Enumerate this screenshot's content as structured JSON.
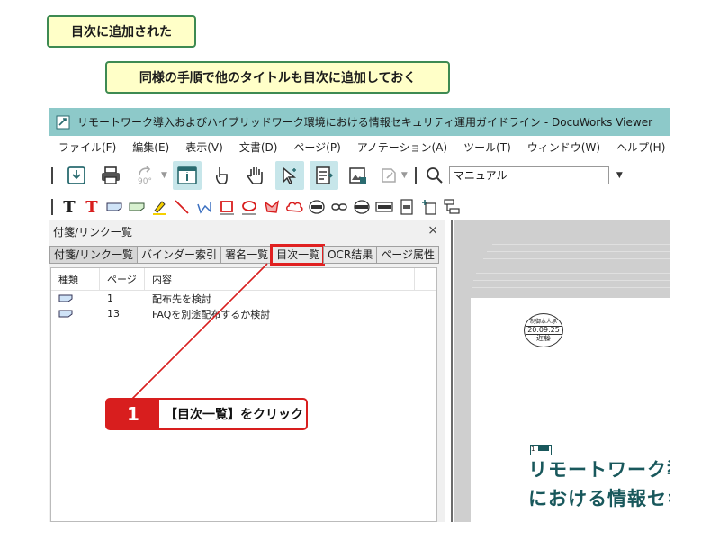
{
  "callouts": {
    "added": "目次に追加された",
    "repeat": "同様の手順で他のタイトルも目次に追加しておく"
  },
  "window": {
    "title": "リモートワーク導入およびハイブリッドワーク環境における情報セキュリティ運用ガイドライン - DocuWorks Viewer",
    "menu": [
      "ファイル(F)",
      "編集(E)",
      "表示(V)",
      "文書(D)",
      "ページ(P)",
      "アノテーション(A)",
      "ツール(T)",
      "ウィンドウ(W)",
      "ヘルプ(H)"
    ],
    "toolbar": {
      "rotate_label": "90°",
      "search_value": "マニュアル"
    }
  },
  "panel": {
    "title": "付箋/リンク一覧",
    "close": "×",
    "tabs": [
      "付箋/リンク一覧",
      "バインダー索引",
      "署名一覧",
      "目次一覧",
      "OCR結果",
      "ページ属性"
    ],
    "columns": [
      "種類",
      "ページ",
      "内容"
    ],
    "rows": [
      {
        "page": "1",
        "content": "配布先を検討"
      },
      {
        "page": "13",
        "content": "FAQを別途配布するか検討"
      }
    ]
  },
  "viewer": {
    "stamp": {
      "top": "制御本人承",
      "date": "20.09.25",
      "name": "近藤"
    },
    "doc_number": "1",
    "title_line1": "リモートワーク導",
    "title_line2": "における情報セキ"
  },
  "step": {
    "number": "1",
    "text": "【目次一覧】をクリック"
  },
  "colors": {
    "titlebar": "#8dc9c9",
    "callout_bg": "#ffffc8",
    "callout_border": "#3d8a52",
    "step_red": "#d81e1e",
    "doc_title": "#19585c"
  }
}
